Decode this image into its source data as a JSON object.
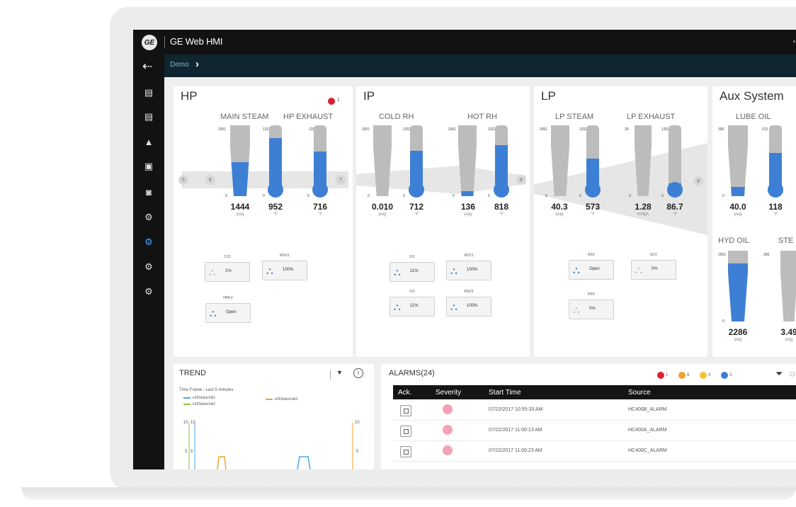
{
  "app": {
    "title": "GE Web HMI",
    "logo_text": "GE"
  },
  "breadcrumb": {
    "label": "Demo"
  },
  "sidebar": {
    "icons": [
      "database-icon",
      "database-icon",
      "alert-icon",
      "image-icon",
      "chart-icon",
      "gears-icon",
      "gears-icon",
      "gears-icon",
      "gears-icon"
    ],
    "active_index": 5
  },
  "panels": {
    "hp": {
      "title": "HP",
      "alarm_count": "1",
      "group_main_steam": "MAIN STEAM",
      "group_hp_exhaust": "HP EXHAUST",
      "gauges": [
        {
          "top": "2001",
          "bottom": "0",
          "value": "1444",
          "unit": "psig",
          "level": 0.48
        },
        {
          "top": "1202",
          "bottom": "0",
          "value": "952",
          "unit": "°F",
          "level": 0.79
        },
        {
          "top": "1202",
          "bottom": "0",
          "value": "716",
          "unit": "°F",
          "level": 0.58
        }
      ],
      "node_labels": [
        "5",
        "6",
        "7"
      ],
      "valves": [
        {
          "name": "CV1",
          "value": "1%",
          "active": false
        },
        {
          "name": "MSV1",
          "value": "100%",
          "active": true
        },
        {
          "name": "HPEV",
          "value": "Open",
          "active": true
        }
      ]
    },
    "ip": {
      "title": "IP",
      "group_cold_rh": "COLD RH",
      "group_hot_rh": "HOT RH",
      "gauges": [
        {
          "top": "2001",
          "bottom": "0",
          "value": "0.010",
          "unit": "psig",
          "level": 0.0
        },
        {
          "top": "1202",
          "bottom": "0",
          "value": "712",
          "unit": "°F",
          "level": 0.59
        },
        {
          "top": "2001",
          "bottom": "0",
          "value": "136",
          "unit": "psig",
          "level": 0.07
        },
        {
          "top": "1202",
          "bottom": "0",
          "value": "818",
          "unit": "°F",
          "level": 0.68
        }
      ],
      "node_labels": [
        "8"
      ],
      "valves": [
        {
          "name": "IV1",
          "value": "11%",
          "active": true
        },
        {
          "name": "RSV1",
          "value": "100%",
          "active": true
        },
        {
          "name": "IV2",
          "value": "11%",
          "active": true
        },
        {
          "name": "RSV2",
          "value": "100%",
          "active": true
        }
      ]
    },
    "lp": {
      "title": "LP",
      "group_lp_steam": "LP STEAM",
      "group_lp_exhaust": "LP EXHAUST",
      "gauges": [
        {
          "top": "2001",
          "bottom": "0",
          "value": "40.3",
          "unit": "psig",
          "level": 0.0
        },
        {
          "top": "1202",
          "bottom": "0",
          "value": "573",
          "unit": "°F",
          "level": 0.47
        },
        {
          "top": "30",
          "bottom": "0",
          "value": "1.28",
          "unit": "inHgA",
          "level": 0.0
        },
        {
          "top": "1202",
          "bottom": "0",
          "value": "86.7",
          "unit": "°F",
          "level": 0.07
        }
      ],
      "node_labels": [
        "9"
      ],
      "valves": [
        {
          "name": "ASV",
          "value": "Open",
          "active": true
        },
        {
          "name": "SCV",
          "value": "0%",
          "active": false
        },
        {
          "name": "PRV",
          "value": "0%",
          "active": false
        }
      ]
    },
    "aux": {
      "title": "Aux System",
      "group_lube_oil": "LUBE OIL",
      "group_hyd_oil": "HYD OIL",
      "group_steam": "STE",
      "gauges": [
        {
          "top": "300",
          "bottom": "0",
          "value": "40.0",
          "unit": "psig",
          "level": 0.13
        },
        {
          "top": "212",
          "bottom": "0",
          "value": "118",
          "unit": "°F",
          "level": 0.56
        },
        {
          "top": "2001",
          "bottom": "0",
          "value": "2286",
          "unit": "psig",
          "level": 0.82
        },
        {
          "top": "300",
          "bottom": "0",
          "value": "3.49",
          "unit": "psig",
          "level": 0.0
        }
      ]
    }
  },
  "trend": {
    "title": "TREND",
    "timeframe": "Time Frame - Last 5 minutes",
    "legend": [
      {
        "label": "e29StatusVal1",
        "color": "#4aa8e8"
      },
      {
        "label": "e29StatusVal3",
        "color": "#f0a030"
      },
      {
        "label": "e29StatusVal2",
        "color": "#8cc63f"
      }
    ],
    "y_labels": [
      "10",
      "10",
      "5",
      "5",
      "10",
      "5"
    ]
  },
  "alarms": {
    "title": "ALARMS(24)",
    "counts": [
      {
        "value": "1",
        "color": "#d92035"
      },
      {
        "value": "8",
        "color": "#f0a030"
      },
      {
        "value": "4",
        "color": "#f2c230"
      },
      {
        "value": "3",
        "color": "#3d7fd4"
      }
    ],
    "columns": [
      "Ack.",
      "Severity",
      "Start Time",
      "Source"
    ],
    "rows": [
      {
        "start": "07/22/2017 10:55:33 AM",
        "source": "HC400B_ALARM"
      },
      {
        "start": "07/22/2017 11:00:13 AM",
        "source": "HC400A_ALARM"
      },
      {
        "start": "07/22/2017 11:00:23 AM",
        "source": "HC400C_ALARM"
      }
    ]
  }
}
